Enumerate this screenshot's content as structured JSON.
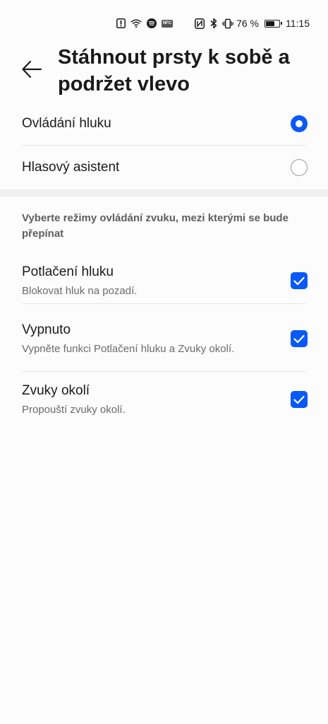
{
  "status_bar": {
    "battery_percent_label": "76 %",
    "battery_level": 0.76,
    "time": "11:15",
    "nfc_label": "NFC",
    "left_icons": [
      "alert-box-icon",
      "wifi-icon",
      "spotify-icon",
      "nfc-app-icon"
    ],
    "right_icons": [
      "nfc-icon",
      "bluetooth-icon",
      "vibrate-icon",
      "battery-icon"
    ]
  },
  "header": {
    "title": "Stáhnout prsty k sobě a podržet vlevo",
    "back_icon": "arrow-left-icon"
  },
  "radio_options": [
    {
      "label": "Ovládání hluku",
      "selected": true
    },
    {
      "label": "Hlasový asistent",
      "selected": false
    }
  ],
  "section": {
    "description": "Vyberte režimy ovládání zvuku, mezi kterými se bude přepínat"
  },
  "modes": [
    {
      "title": "Potlačení hluku",
      "subtitle": "Blokovat hluk na pozadí.",
      "checked": true
    },
    {
      "title": "Vypnuto",
      "subtitle": "Vypněte funkci Potlačení hluku a Zvuky okolí.",
      "checked": true
    },
    {
      "title": "Zvuky okolí",
      "subtitle": "Propouští zvuky okolí.",
      "checked": true
    }
  ],
  "colors": {
    "accent": "#0a59f7",
    "background": "#fcfcfc",
    "divider": "#e6e6e6"
  }
}
